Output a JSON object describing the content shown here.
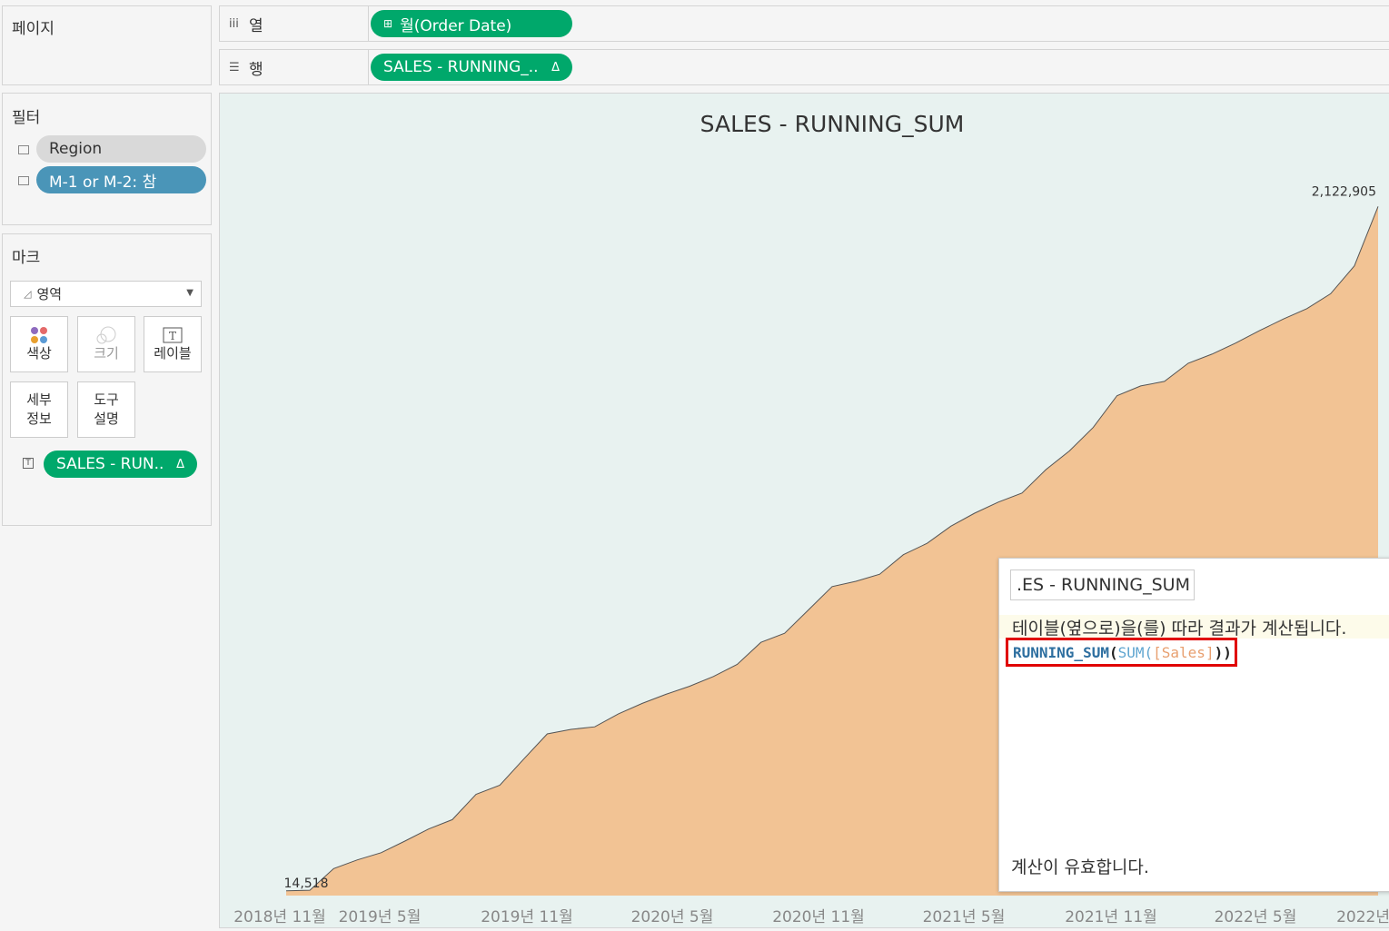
{
  "pages": {
    "title": "페이지"
  },
  "columns_shelf": {
    "label": "열",
    "pill": "월(Order Date)"
  },
  "rows_shelf": {
    "label": "행",
    "pill": "SALES - RUNNING_..",
    "pill_delta": "Δ"
  },
  "filters": {
    "title": "필터",
    "items": [
      {
        "label": "Region"
      },
      {
        "label": "M-1 or M-2: 참"
      }
    ]
  },
  "marks": {
    "title": "마크",
    "mark_type": "영역",
    "cards": {
      "color": "색상",
      "size": "크기",
      "label": "레이블",
      "detail_1": "세부",
      "detail_2": "정보",
      "tooltip_1": "도구",
      "tooltip_2": "설명"
    },
    "pill": "SALES - RUN..",
    "pill_delta": "Δ"
  },
  "colors": {
    "area_fill": "#f2c394",
    "area_line": "#555555",
    "background": "#e8f2f0",
    "pill_green": "#00a86b",
    "pill_blue": "#4a95b8"
  },
  "chart_data": {
    "type": "area",
    "title": "SALES - RUNNING_SUM",
    "x_tick_labels": [
      "2018년 11월",
      "2019년 5월",
      "2019년 11월",
      "2020년 5월",
      "2020년 11월",
      "2021년 5월",
      "2021년 11월",
      "2022년 5월",
      "2022년"
    ],
    "x": [
      "2018-11",
      "2018-12",
      "2019-01",
      "2019-02",
      "2019-03",
      "2019-04",
      "2019-05",
      "2019-06",
      "2019-07",
      "2019-08",
      "2019-09",
      "2019-10",
      "2019-11",
      "2019-12",
      "2020-01",
      "2020-02",
      "2020-03",
      "2020-04",
      "2020-05",
      "2020-06",
      "2020-07",
      "2020-08",
      "2020-09",
      "2020-10",
      "2020-11",
      "2020-12",
      "2021-01",
      "2021-02",
      "2021-03",
      "2021-04",
      "2021-05",
      "2021-06",
      "2021-07",
      "2021-08",
      "2021-09",
      "2021-10",
      "2021-11",
      "2021-12",
      "2022-01",
      "2022-02",
      "2022-03",
      "2022-04",
      "2022-05",
      "2022-06",
      "2022-07",
      "2022-08",
      "2022-09"
    ],
    "values": [
      14518,
      16500,
      83000,
      110000,
      132000,
      168000,
      205000,
      234000,
      312000,
      340000,
      420000,
      498000,
      512000,
      520000,
      560000,
      592000,
      620000,
      645000,
      675000,
      712000,
      780000,
      808000,
      880000,
      952000,
      968000,
      990000,
      1050000,
      1085000,
      1138000,
      1178000,
      1212000,
      1240000,
      1312000,
      1370000,
      1442000,
      1540000,
      1570000,
      1584000,
      1640000,
      1668000,
      1702000,
      1740000,
      1776000,
      1808000,
      1854000,
      1940000,
      2122905
    ],
    "data_labels": [
      {
        "x": "2018-11",
        "text": "14,518"
      },
      {
        "x": "2022-09",
        "text": "2,122,905"
      }
    ],
    "ylim": [
      0,
      2300000
    ]
  },
  "tooltip": {
    "name": ".ES - RUNNING_SUM",
    "description": "테이블(옆으로)을(를) 따라 결과가 계산됩니다.",
    "formula": {
      "keyword": "RUNNING_SUM",
      "open": "(",
      "fn": "SUM(",
      "field": "[Sales]",
      "close": "))"
    },
    "status": "계산이 유효합니다."
  }
}
